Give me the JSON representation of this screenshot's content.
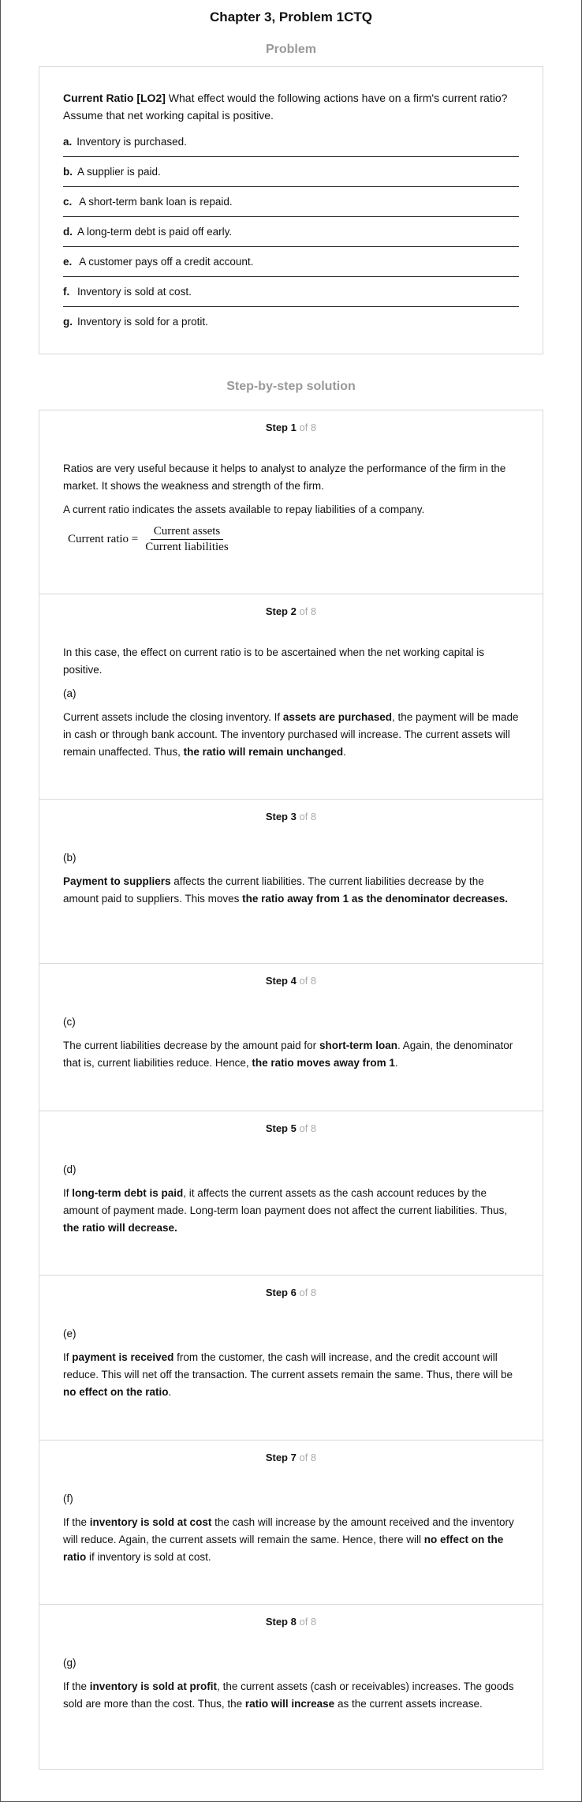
{
  "page_title": "Chapter 3, Problem 1CTQ",
  "problem": {
    "heading": "Problem",
    "intro_bold": "Current Ratio [LO2]",
    "intro_rest": " What effect would the following actions have on a firm's current ratio? Assume that net working capital is positive.",
    "options": [
      {
        "letter": "a.",
        "text": "Inventory is purchased."
      },
      {
        "letter": "b.",
        "text": "A supplier is paid."
      },
      {
        "letter": "c.",
        "text": " A short-term bank loan is repaid."
      },
      {
        "letter": "d.",
        "text": "A long-term debt is paid off early."
      },
      {
        "letter": "e.",
        "text": " A customer pays off a credit account."
      },
      {
        "letter": "f.",
        "text": " Inventory is sold at cost."
      },
      {
        "letter": "g.",
        "text": "Inventory is sold for a protit."
      }
    ]
  },
  "solution": {
    "heading": "Step-by-step solution",
    "of_text": "of 8",
    "steps": [
      {
        "label": "Step 1",
        "p1": "Ratios are very useful because it helps to analyst to analyze the performance of the firm in the market. It shows the weakness and strength of the firm.",
        "p2": "A current ratio indicates the assets available to repay liabilities of a company.",
        "formula_lhs": "Current ratio =",
        "formula_num": "Current assets",
        "formula_den": "Current liabilities"
      },
      {
        "label": "Step 2",
        "p1": "In this case, the effect on current ratio is to be ascertained when the net working capital is positive.",
        "part": "(a)",
        "t1": "Current assets include the closing inventory. If ",
        "b1": "assets are purchased",
        "t2": ", the payment will be made in cash or through bank account. The inventory purchased will increase. The current assets will remain unaffected. Thus, ",
        "b2": "the ratio will remain unchanged",
        "t3": "."
      },
      {
        "label": "Step 3",
        "part": "(b)",
        "b1": "Payment to suppliers",
        "t1": " affects the current liabilities. The current liabilities decrease by the amount paid to suppliers. This moves ",
        "b2": "the ratio away from 1 as the denominator decreases."
      },
      {
        "label": "Step 4",
        "part": "(c)",
        "t1": "The current liabilities decrease by the amount paid for ",
        "b1": "short-term loan",
        "t2": ". Again, the denominator that is, current liabilities reduce. Hence, ",
        "b2": "the ratio moves away from 1",
        "t3": "."
      },
      {
        "label": "Step 5",
        "part": "(d)",
        "t1": "If ",
        "b1": "long-term debt is paid",
        "t2": ", it affects the current assets as the cash account reduces by the amount of payment made. Long-term loan payment does not affect the current liabilities. Thus, ",
        "b2": "the ratio will decrease."
      },
      {
        "label": "Step 6",
        "part": "(e)",
        "t1": "If ",
        "b1": "payment is received",
        "t2": " from the customer, the cash will increase, and the credit account will reduce. This will net off the transaction. The current assets remain the same. Thus, there will be ",
        "b2": "no effect on the ratio",
        "t3": "."
      },
      {
        "label": "Step 7",
        "part": "(f)",
        "t1": "If the ",
        "b1": "inventory is sold at cost",
        "t2": " the cash will increase by the amount received and the inventory will reduce. Again, the current assets will remain the same. Hence, there will ",
        "b2": "no effect on the ratio",
        "t3": " if inventory is sold at cost."
      },
      {
        "label": "Step 8",
        "part": "(g)",
        "t1": "If the ",
        "b1": "inventory is sold at profit",
        "t2": ", the current assets (cash or receivables) increases. The goods sold are more than the cost. Thus, the ",
        "b2": "ratio will increase",
        "t3": " as the current assets increase."
      }
    ]
  }
}
